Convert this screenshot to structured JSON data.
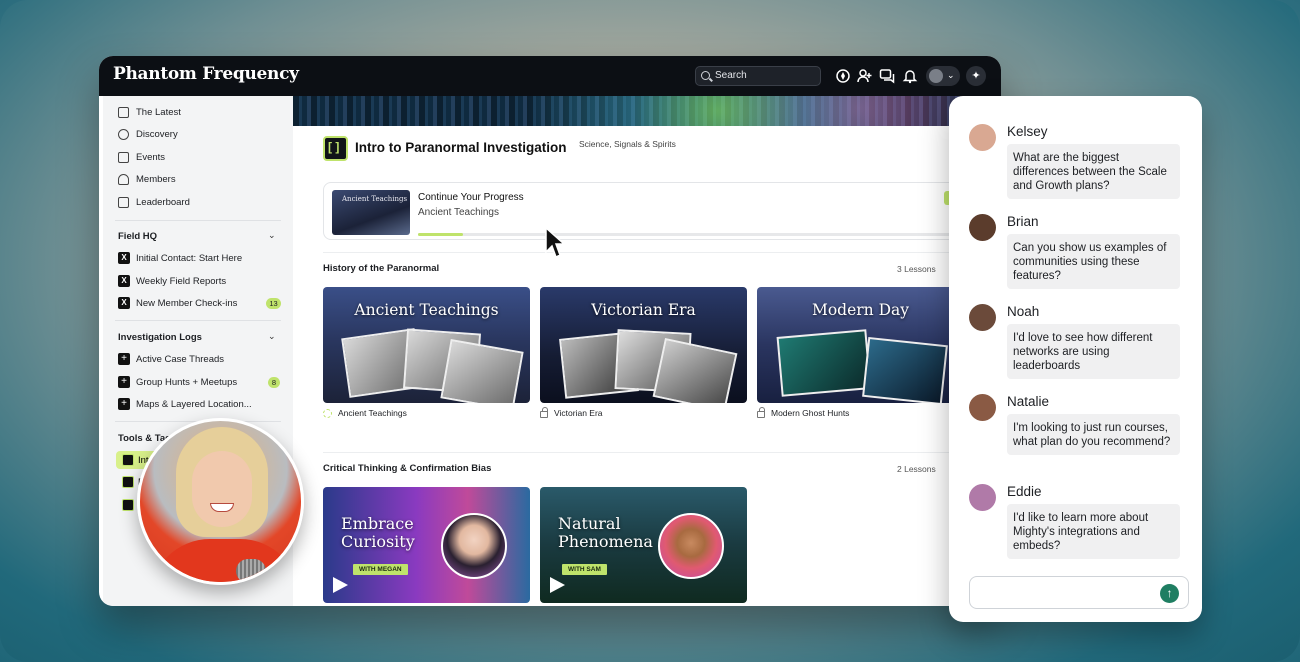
{
  "app": {
    "brand": "Phantom Frequency"
  },
  "topbar": {
    "search_label": "Search"
  },
  "sidebar": {
    "items": [
      {
        "label": "The Latest",
        "icon": "layers-icon"
      },
      {
        "label": "Discovery",
        "icon": "compass-icon"
      },
      {
        "label": "Events",
        "icon": "calendar-icon"
      },
      {
        "label": "Members",
        "icon": "users-icon"
      },
      {
        "label": "Leaderboard",
        "icon": "leaderboard-icon"
      }
    ],
    "field_hq": {
      "title": "Field HQ",
      "items": [
        {
          "label": "Initial Contact: Start Here"
        },
        {
          "label": "Weekly Field Reports"
        },
        {
          "label": "New Member Check-ins",
          "count": "13"
        }
      ]
    },
    "investigation_logs": {
      "title": "Investigation Logs",
      "items": [
        {
          "label": "Active Case Threads"
        },
        {
          "label": "Group Hunts + Meetups",
          "count": "8"
        },
        {
          "label": "Maps & Layered Location..."
        }
      ]
    },
    "tools": {
      "title": "Tools & Tac",
      "items": [
        {
          "label": "Int"
        },
        {
          "label": "E"
        },
        {
          "label": ""
        }
      ]
    }
  },
  "course": {
    "title": "Intro to Paranormal Investigation",
    "subtitle": "Science, Signals & Spirits",
    "progress": {
      "title": "Continue Your Progress",
      "lesson": "Ancient Teachings",
      "thumb_title": "Ancient Teachings",
      "fraction": 0.08
    }
  },
  "sections": [
    {
      "title": "History of the Paranormal",
      "count": "3 Lessons",
      "lessons": [
        {
          "thumb_title": "Ancient Teachings",
          "caption": "Ancient Teachings",
          "status": "in-progress"
        },
        {
          "thumb_title": "Victorian Era",
          "caption": "Victorian Era",
          "status": "locked"
        },
        {
          "thumb_title": "Modern Day",
          "caption": "Modern Ghost Hunts",
          "status": "locked"
        }
      ]
    },
    {
      "title": "Critical Thinking & Confirmation Bias",
      "count": "2 Lessons",
      "videos": [
        {
          "title_line1": "Embrace",
          "title_line2": "Curiosity",
          "host": "WITH MEGAN"
        },
        {
          "title_line1": "Natural",
          "title_line2": "Phenomena",
          "host": "WITH SAM"
        }
      ]
    }
  ],
  "chat": {
    "messages": [
      {
        "name": "Kelsey",
        "text": "What are the biggest differences between the Scale and Growth plans?",
        "avatar_color": "#d9a892"
      },
      {
        "name": "Brian",
        "text": "Can you show us examples of communities using these features?",
        "avatar_color": "#5b3c2c"
      },
      {
        "name": "Noah",
        "text": "I'd love to see how different networks are using leaderboards",
        "avatar_color": "#6b4a3a"
      },
      {
        "name": "Natalie",
        "text": "I'm looking to just run courses, what plan do you recommend?",
        "avatar_color": "#8a5a44"
      },
      {
        "name": "Eddie",
        "text": "I'd like to learn more about Mighty's integrations and embeds?",
        "avatar_color": "#b07aa8"
      }
    ],
    "input_placeholder": ""
  }
}
